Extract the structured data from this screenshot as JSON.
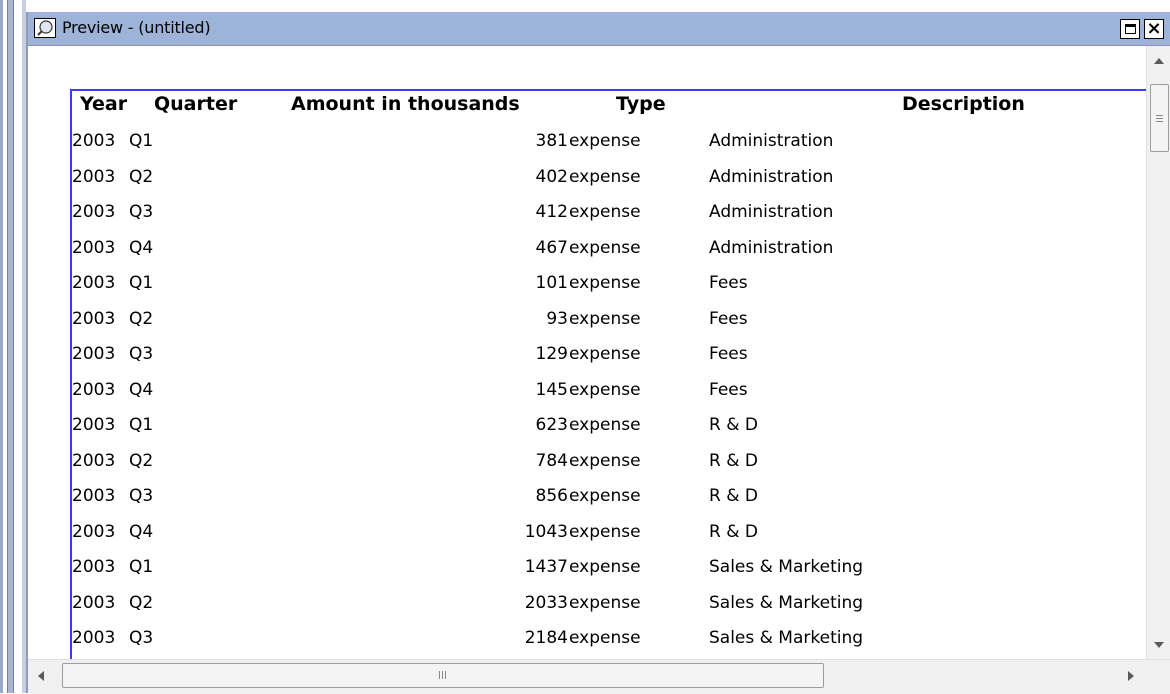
{
  "window": {
    "title": "Preview - (untitled)",
    "close_glyph": "×",
    "icons": [
      "preview-app-icon",
      "maximize-icon",
      "close-icon"
    ]
  },
  "report": {
    "columns": {
      "year": "Year",
      "quarter": "Quarter",
      "amount": "Amount in thousands",
      "type": "Type",
      "description": "Description"
    },
    "rows": [
      {
        "year": "2003",
        "quarter": "Q1",
        "amount": "381",
        "type": "expense",
        "description": "Administration"
      },
      {
        "year": "2003",
        "quarter": "Q2",
        "amount": "402",
        "type": "expense",
        "description": "Administration"
      },
      {
        "year": "2003",
        "quarter": "Q3",
        "amount": "412",
        "type": "expense",
        "description": "Administration"
      },
      {
        "year": "2003",
        "quarter": "Q4",
        "amount": "467",
        "type": "expense",
        "description": "Administration"
      },
      {
        "year": "2003",
        "quarter": "Q1",
        "amount": "101",
        "type": "expense",
        "description": "Fees"
      },
      {
        "year": "2003",
        "quarter": "Q2",
        "amount": "93",
        "type": "expense",
        "description": "Fees"
      },
      {
        "year": "2003",
        "quarter": "Q3",
        "amount": "129",
        "type": "expense",
        "description": "Fees"
      },
      {
        "year": "2003",
        "quarter": "Q4",
        "amount": "145",
        "type": "expense",
        "description": "Fees"
      },
      {
        "year": "2003",
        "quarter": "Q1",
        "amount": "623",
        "type": "expense",
        "description": "R & D"
      },
      {
        "year": "2003",
        "quarter": "Q2",
        "amount": "784",
        "type": "expense",
        "description": "R & D"
      },
      {
        "year": "2003",
        "quarter": "Q3",
        "amount": "856",
        "type": "expense",
        "description": "R & D"
      },
      {
        "year": "2003",
        "quarter": "Q4",
        "amount": "1043",
        "type": "expense",
        "description": "R & D"
      },
      {
        "year": "2003",
        "quarter": "Q1",
        "amount": "1437",
        "type": "expense",
        "description": "Sales & Marketing"
      },
      {
        "year": "2003",
        "quarter": "Q2",
        "amount": "2033",
        "type": "expense",
        "description": "Sales & Marketing"
      },
      {
        "year": "2003",
        "quarter": "Q3",
        "amount": "2184",
        "type": "expense",
        "description": "Sales & Marketing"
      }
    ]
  },
  "colors": {
    "titlebar": "#9db3d7",
    "report_border": "#3a3aff"
  }
}
